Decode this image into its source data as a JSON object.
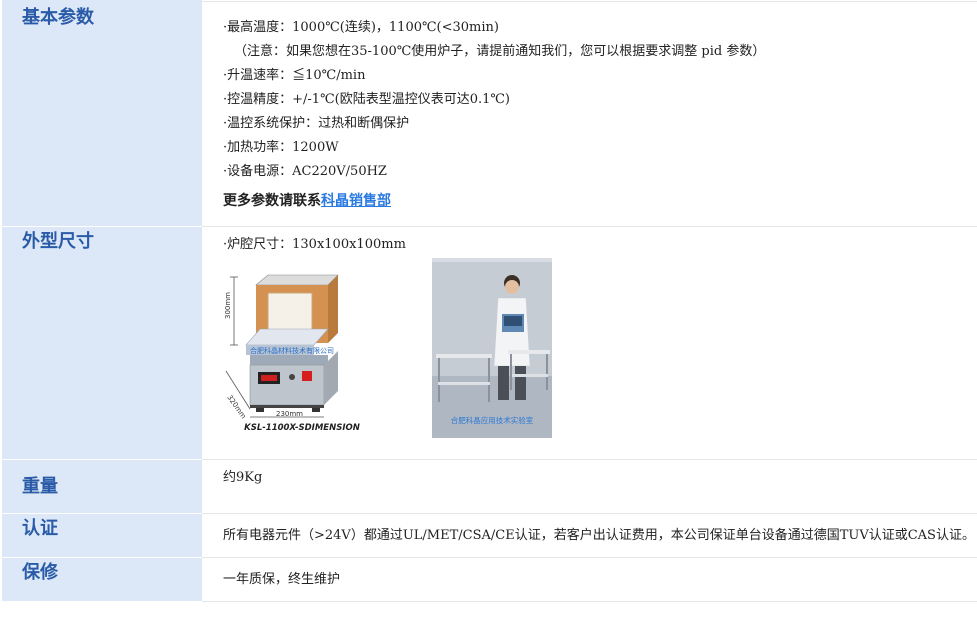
{
  "rows": {
    "basic": {
      "label": "基本参数",
      "lines": [
        "最高温度：1000℃(连续)，1100℃(<30min)",
        "控温精度：+/-1℃(欧陆表型温控仪表可达0.1℃)",
        "温控系统保护：过热和断偶保护",
        "加热功率：1200W",
        "设备电源：AC220V/50HZ"
      ],
      "note": "（注意：如果您想在35-100℃使用炉子，请提前通知我们，您可以根据要求调整 pid 参数）",
      "rate": "升温速率：≦10℃/min",
      "more_prefix": "更多参数请联系",
      "more_link": "科晶销售部"
    },
    "size": {
      "label": "外型尺寸",
      "line": "炉腔尺寸：130x100x100mm",
      "img1": {
        "dim_height": "300mm",
        "dim_depth": "320mm",
        "dim_width": "230mm",
        "watermark": "合肥科晶材料技术有限公司",
        "caption": "KSL-1100X-SDIMENSION"
      },
      "img2": {
        "watermark": "合肥科晶应用技术实验室"
      }
    },
    "weight": {
      "label": "重量",
      "value": "约9Kg"
    },
    "cert": {
      "label": "认证",
      "value": "所有电器元件（>24V）都通过UL/MET/CSA/CE认证，若客户出认证费用，本公司保证单台设备通过德国TUV认证或CAS认证。"
    },
    "warranty": {
      "label": "保修",
      "value": "一年质保，终生维护"
    }
  }
}
